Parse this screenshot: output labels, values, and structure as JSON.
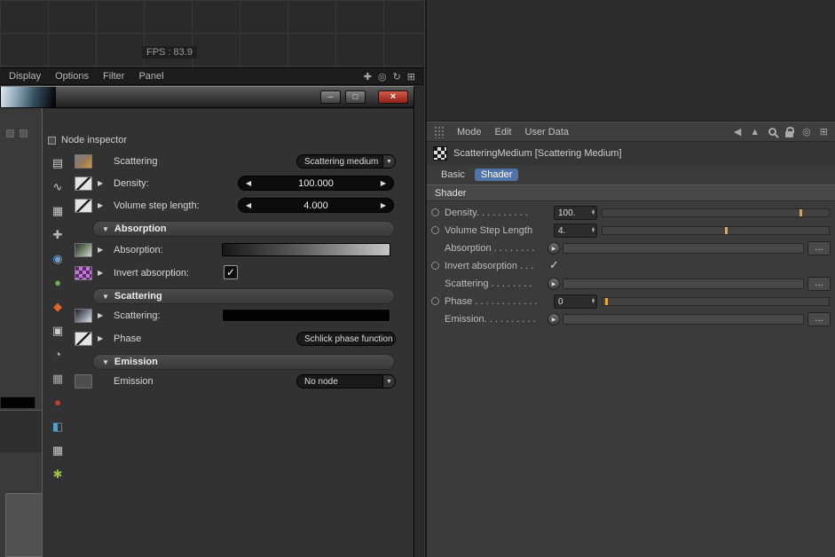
{
  "colors": {
    "accent_orange": "#eda33b",
    "tab_active_bg": "#4f74a8",
    "close_red": "#8d1f14"
  },
  "glyphs": {
    "dropdown": "▼",
    "left_arrow": "◀",
    "right_arrow": "▶",
    "expander": "▶",
    "section_arrow": "▼",
    "check": "✓",
    "spin_up": "▴",
    "spin_down": "▾",
    "play": "▶",
    "minimize": "─",
    "maximize": "□",
    "close": "×",
    "pan": "✚",
    "dolly": "◎",
    "rotate": "↻",
    "toggle_view": "⊞",
    "back": "◀",
    "cursor": "▲",
    "target": "◎",
    "add": "⊞"
  },
  "viewport": {
    "fps": "FPS : 83.9",
    "menu": {
      "display": "Display",
      "options": "Options",
      "filter": "Filter",
      "panel": "Panel"
    }
  },
  "window": {
    "toolbar_icons": [
      {
        "name": "layers-icon",
        "glyph": "▤",
        "color": "#cccccc"
      },
      {
        "name": "spline-icon",
        "glyph": "∿",
        "color": "#cccccc"
      },
      {
        "name": "image-icon",
        "glyph": "▦",
        "color": "#c8c8c8"
      },
      {
        "name": "axis-icon",
        "glyph": "✚",
        "color": "#b8b8b8"
      },
      {
        "name": "blue-material-icon",
        "glyph": "◉",
        "color": "#6fa0d0"
      },
      {
        "name": "green-sphere-icon",
        "glyph": "●",
        "color": "#6fae55"
      },
      {
        "name": "orange-drop-icon",
        "glyph": "◆",
        "color": "#e06428"
      },
      {
        "name": "monitor-icon",
        "glyph": "▣",
        "color": "#c8c8c8"
      },
      {
        "name": "clock-icon",
        "glyph": "◔",
        "color": "#c8c8c8"
      },
      {
        "name": "checker-icon",
        "glyph": "▦",
        "color": "#a8a8a8"
      },
      {
        "name": "red-material-icon",
        "glyph": "●",
        "color": "#d23a28"
      },
      {
        "name": "cyan-layers-icon",
        "glyph": "◧",
        "color": "#58a0cc"
      },
      {
        "name": "picture-icon",
        "glyph": "▦",
        "color": "#c8c8c8"
      },
      {
        "name": "star-icon",
        "glyph": "✱",
        "color": "#9cc244"
      }
    ],
    "inspector": {
      "title": "Node inspector",
      "node_label": "Scattering",
      "node_dropdown": "Scattering medium",
      "density": {
        "label": "Density:",
        "value": "100.000"
      },
      "volume_step": {
        "label": "Volume step length:",
        "value": "4.000"
      },
      "absorption_section": "Absorption",
      "absorption": {
        "label": "Absorption:"
      },
      "invert": {
        "label": "Invert absorption:"
      },
      "scattering_section": "Scattering",
      "scattering": {
        "label": "Scattering:"
      },
      "phase": {
        "label": "Phase",
        "dropdown": "Schlick phase function"
      },
      "emission_section": "Emission",
      "emission": {
        "label": "Emission",
        "dropdown": "No node"
      }
    }
  },
  "attributes": {
    "menu": {
      "mode": "Mode",
      "edit": "Edit",
      "user_data": "User Data"
    },
    "object_title": "ScatteringMedium [Scattering Medium]",
    "tabs": {
      "basic": "Basic",
      "shader": "Shader"
    },
    "section": "Shader",
    "rows": {
      "density": {
        "label": "Density. . . . . . . . . .",
        "value": "100.",
        "slider_pct": 87
      },
      "volume_step": {
        "label": "Volume Step Length",
        "value": "4.",
        "slider_pct": 54
      },
      "absorption": {
        "label": "Absorption . . . . . . . .",
        "more": "..."
      },
      "invert": {
        "label": "Invert absorption . . ."
      },
      "scattering": {
        "label": "Scattering . . . . . . . .",
        "more": "..."
      },
      "phase": {
        "label": "Phase . . . . . . . . . . . .",
        "value": "0",
        "slider_pct": 1
      },
      "emission": {
        "label": "Emission. . . . . . . . . .",
        "more": "..."
      }
    }
  }
}
